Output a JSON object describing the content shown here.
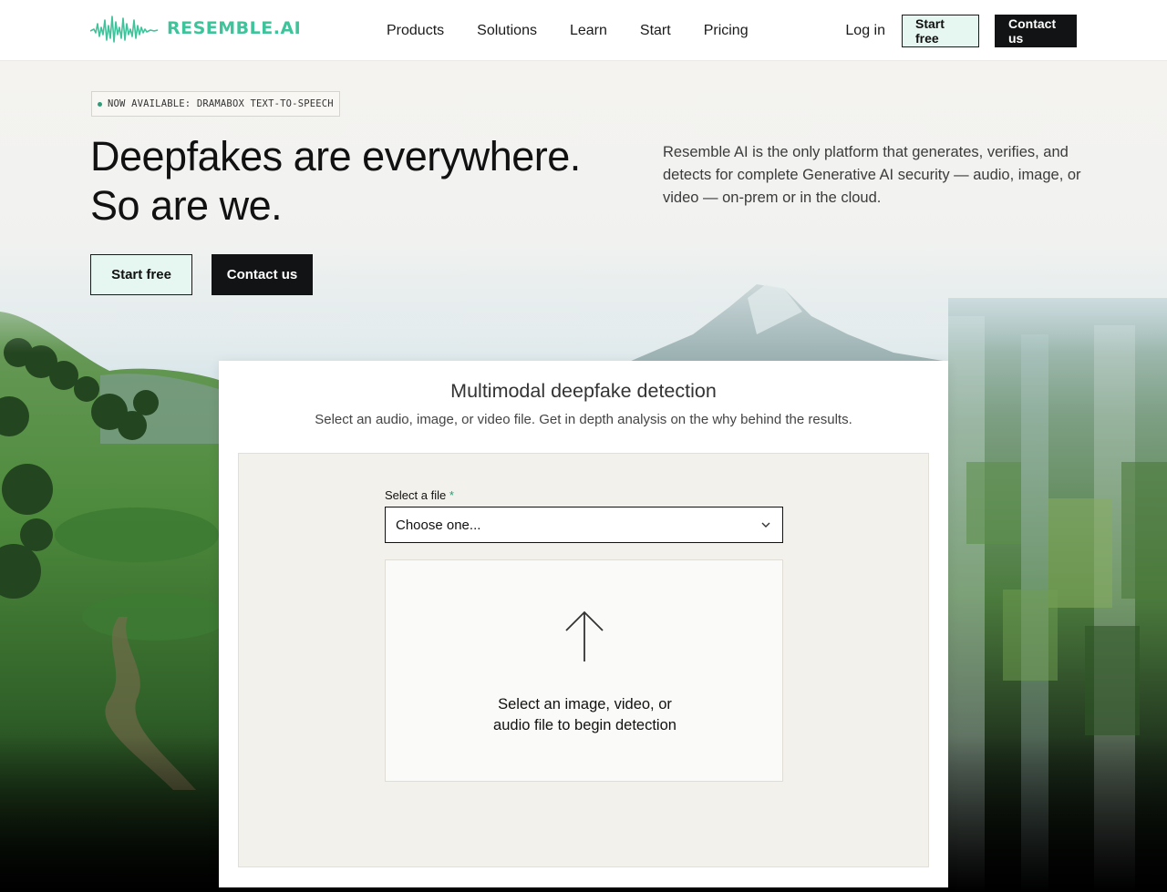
{
  "brand": {
    "name": "RESEMBLE.AI",
    "color": "#3fc39b"
  },
  "nav": {
    "items": [
      {
        "label": "Products"
      },
      {
        "label": "Solutions"
      },
      {
        "label": "Learn"
      },
      {
        "label": "Start"
      },
      {
        "label": "Pricing"
      }
    ],
    "login": "Log in",
    "start_free": "Start free",
    "contact": "Contact us"
  },
  "hero": {
    "badge": "NOW AVAILABLE: DRAMABOX TEXT-TO-SPEECH",
    "title_line1": "Deepfakes are everywhere.",
    "title_line2": "So are we.",
    "description": "Resemble AI is the only platform that generates, verifies, and detects for complete Generative AI security — audio, image, or video — on-prem or in the cloud.",
    "cta_primary": "Start free",
    "cta_secondary": "Contact us"
  },
  "detector": {
    "title": "Multimodal deepfake detection",
    "subtitle": "Select an audio, image, or video file. Get in depth analysis on the why behind the results.",
    "field_label": "Select a file",
    "required_mark": "*",
    "select_value": "Choose one...",
    "drop_line1": "Select an image, video, or",
    "drop_line2": "audio file to begin detection",
    "icons": {
      "upload": "upload-arrow-icon",
      "chevron": "chevron-down-icon"
    }
  },
  "colors": {
    "accent": "#3fc39b",
    "dark_button": "#121314",
    "light_button": "#e6f7f2"
  }
}
